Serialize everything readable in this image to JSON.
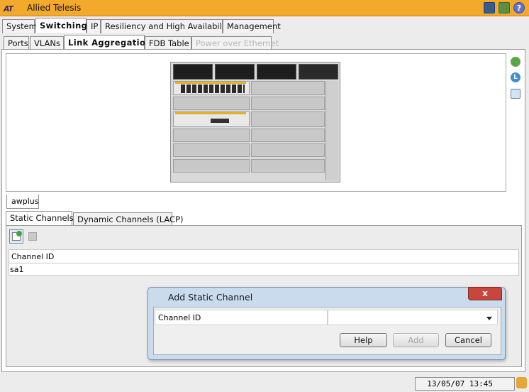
{
  "app": {
    "logo_text": "AT",
    "title": "Allied Telesis"
  },
  "titlebar_icons": [
    "save-icon",
    "network-icon",
    "help-icon"
  ],
  "main_tabs": [
    {
      "label": "System"
    },
    {
      "label": "Switching",
      "active": true
    },
    {
      "label": "IP"
    },
    {
      "label": "Resiliency and High Availability"
    },
    {
      "label": "Management"
    }
  ],
  "sub_tabs": [
    {
      "label": "Ports"
    },
    {
      "label": "VLANs"
    },
    {
      "label": "Link Aggregation",
      "active": true
    },
    {
      "label": "FDB Table"
    },
    {
      "label": "Power over Ethernet",
      "disabled": true
    }
  ],
  "device_tab": "awplus",
  "channel_tabs": [
    {
      "label": "Static Channels",
      "active": true
    },
    {
      "label": "Dynamic Channels (LACP)"
    }
  ],
  "table": {
    "column": "Channel ID",
    "rows": [
      "sa1"
    ]
  },
  "dialog": {
    "title": "Add Static Channel",
    "close_label": "x",
    "field_label": "Channel ID",
    "field_value": "",
    "buttons": {
      "help": "Help",
      "add": "Add",
      "cancel": "Cancel"
    }
  },
  "status": {
    "datetime": "13/05/07 13:45"
  },
  "colors": {
    "titlebar": "#f3a92c",
    "dialog_frame": "#c9dcee",
    "close_button": "#c8463e"
  }
}
